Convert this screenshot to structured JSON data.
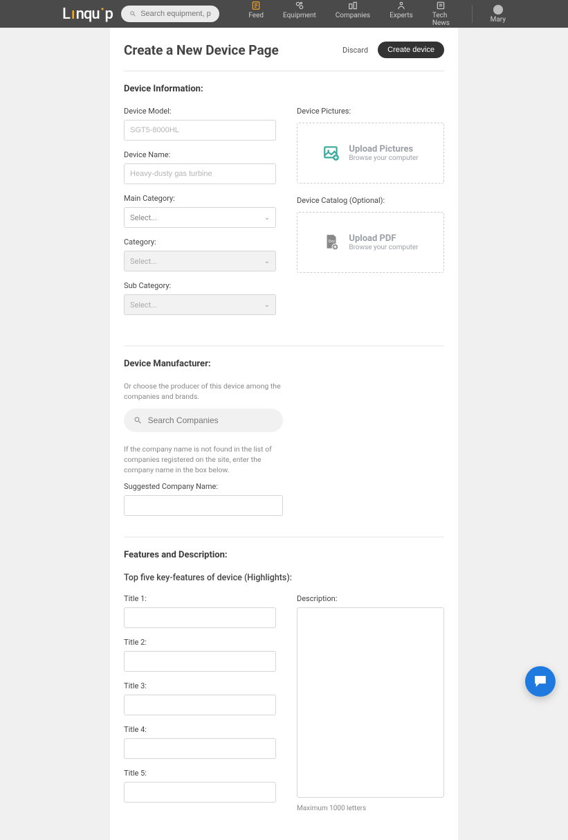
{
  "header": {
    "search_placeholder": "Search equipment, providers or expert",
    "nav": {
      "feed": "Feed",
      "equipment": "Equipment",
      "companies": "Companies",
      "experts": "Experts",
      "tech_news": "Tech News"
    },
    "user_name": "Mary"
  },
  "page": {
    "title": "Create a New Device Page",
    "discard": "Discard",
    "create": "Create device"
  },
  "device_info": {
    "section": "Device Information:",
    "model_label": "Device Model:",
    "model_placeholder": "SGT5-8000HL",
    "name_label": "Device Name:",
    "name_placeholder": "Heavy-dusty gas turbine",
    "main_cat_label": "Main Category:",
    "main_cat_value": "Select...",
    "cat_label": "Category:",
    "cat_value": "Select...",
    "subcat_label": "Sub Category:",
    "subcat_value": "Select...",
    "pictures_label": "Device Pictures:",
    "upload_pic_title": "Upload Pictures",
    "upload_pic_sub": "Browse your computer",
    "catalog_label": "Device Catalog (Optional):",
    "upload_pdf_title": "Upload PDF",
    "upload_pdf_sub": "Browse your computer"
  },
  "manufacturer": {
    "section": "Device Manufacturer:",
    "hint1": "Or choose the producer of this device among the companies and brands.",
    "search_placeholder": "Search Companies",
    "hint2": "If the company name is not found in the list of companies registered on the site, enter the company name in the box below.",
    "suggested_label": "Suggested Company Name:"
  },
  "features": {
    "section": "Features and Description:",
    "subheading": "Top five key-features of device (Highlights):",
    "title1": "Title 1:",
    "title2": "Title 2:",
    "title3": "Title 3:",
    "title4": "Title 4:",
    "title5": "Title 5:",
    "desc_label": "Description:",
    "char_hint": "Maximum 1000 letters"
  }
}
